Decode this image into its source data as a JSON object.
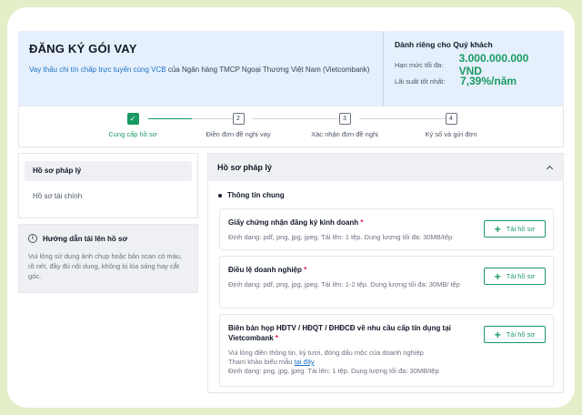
{
  "header": {
    "title": "ĐĂNG KÝ GÓI VAY",
    "subtitle_link": "Vay thấu chi tín chấp trực tuyến cùng VCB",
    "subtitle_rest": " của Ngân hàng TMCP Ngoại Thương Việt Nam (Vietcombank)",
    "offer_title": "Dành riêng cho Quý khách",
    "limit_label": "Hạn mức tối đa:",
    "limit_value": "3.000.000.000 VND",
    "rate_label": "Lãi suất tốt nhất:",
    "rate_value": "7,39%/năm"
  },
  "stepper": {
    "steps": [
      {
        "number": "✓",
        "label": "Cung cấp hồ sơ",
        "active": true
      },
      {
        "number": "2",
        "label": "Điền đơn đề nghị vay",
        "active": false
      },
      {
        "number": "3",
        "label": "Xác nhận đơn đề nghị",
        "active": false
      },
      {
        "number": "4",
        "label": "Ký số và gửi đơn",
        "active": false
      }
    ]
  },
  "sidebar": {
    "items": [
      {
        "label": "Hồ sơ pháp lý",
        "active": true
      },
      {
        "label": "Hồ sơ tài chính",
        "active": false
      }
    ]
  },
  "guide": {
    "icon": "info-icon",
    "title": "Hướng dẫn tải lên hồ sơ",
    "text": "Vui lòng sử dụng ảnh chụp hoặc bản scan có màu, rõ nét, đầy đủ nội dung, không bị lóa sáng hay cắt góc."
  },
  "panel": {
    "title": "Hồ sơ pháp lý",
    "section": "Thông tin chung",
    "upload_label": "Tải hồ sơ",
    "docs": [
      {
        "title": "Giấy chứng nhận đăng ký kinh doanh",
        "desc": "Định dạng: pdf, png, jpg, jpeg. Tải lên: 1 tệp. Dung lượng tối đa: 30MB/tệp"
      },
      {
        "title": "Điều lệ doanh nghiệp",
        "desc": "Định dạng: pdf, png, jpg, jpeg. Tải lên: 1-2 tệp. Dung lượng tối đa: 30MB/ tệp"
      },
      {
        "title": "Biên bản họp HĐTV / HĐQT / ĐHĐCĐ về nhu cầu cấp tín dụng tại Vietcombank",
        "desc_line1": "Vui lòng điền thông tin, ký tươi, đóng dấu mộc của doanh nghiệp",
        "desc_ref": "Tham khảo biểu mẫu ",
        "desc_ref_link": "tại đây",
        "desc_line3": "Định dạng: png, jpg, jpeg. Tải lên: 1 tệp. Dung lượng tối đa: 30MB/tệp"
      }
    ]
  },
  "colors": {
    "accent": "#1a9a62",
    "link": "#1a73c7",
    "required": "#e11d48",
    "header_bg": "#e6f0fc"
  }
}
